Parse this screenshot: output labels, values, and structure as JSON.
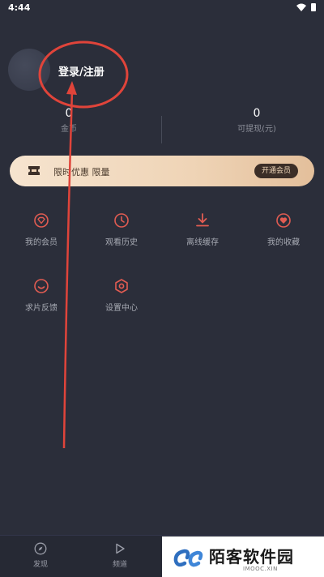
{
  "status_bar": {
    "time": "4:44"
  },
  "profile": {
    "login_label": "登录/注册"
  },
  "stats": {
    "coins": {
      "value": "0",
      "label": "金币"
    },
    "cash": {
      "value": "0",
      "label": "可提现(元)"
    }
  },
  "vip_banner": {
    "text": "限时优惠 限量",
    "button_label": "开通会员",
    "icon": "ticket-icon"
  },
  "grid": [
    {
      "label": "我的会员",
      "icon": "vip-diamond-icon"
    },
    {
      "label": "观看历史",
      "icon": "clock-icon"
    },
    {
      "label": "离线缓存",
      "icon": "download-icon"
    },
    {
      "label": "我的收藏",
      "icon": "heart-icon"
    },
    {
      "label": "求片反馈",
      "icon": "feedback-smile-icon"
    },
    {
      "label": "设置中心",
      "icon": "settings-hexagon-icon"
    }
  ],
  "bottom_nav": [
    {
      "label": "发现",
      "icon": "compass-icon"
    },
    {
      "label": "频道",
      "icon": "play-icon"
    }
  ],
  "watermark": {
    "title": "陌客软件园",
    "subtitle": "IMOOC.XIN"
  },
  "colors": {
    "background": "#2b2e3a",
    "accent_icon": "#e25c52",
    "annotation": "#e0443a",
    "vip_gold": "#efd4b6"
  }
}
